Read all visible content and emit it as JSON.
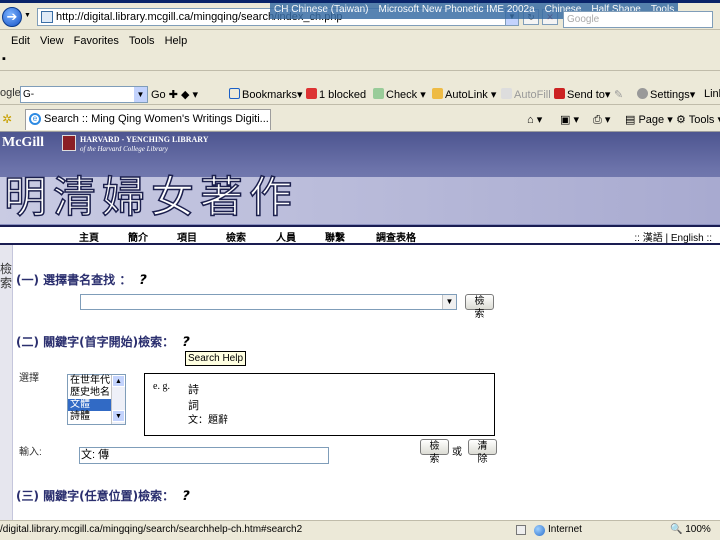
{
  "browser": {
    "address_url": "http://digital.library.mcgill.ca/mingqing/search/index_ch.php",
    "language_bar": [
      "CH Chinese (Taiwan)",
      "Microsoft New Phonetic IME 2002a",
      "Chinese",
      "Half Shape",
      "Tools"
    ],
    "search_placeholder": "Google",
    "menu": [
      "Edit",
      "View",
      "Favorites",
      "Tools",
      "Help"
    ],
    "google_toolbar": {
      "logo": "ogle",
      "combo_value": "G-",
      "go": "Go",
      "bookmarks": "Bookmarks",
      "blocked": "1 blocked",
      "check": "Check",
      "autolink": "AutoLink",
      "autofill": "AutoFill",
      "sendto": "Send to",
      "settings": "Settings",
      "link": "Link"
    },
    "tab_title": "Search :: Ming Qing Women's Writings Digiti...",
    "commands": {
      "page": "Page",
      "tools": "Tools"
    },
    "status": {
      "url": "/digital.library.mcgill.ca/mingqing/search/searchhelp-ch.htm#search2",
      "zone": "Internet",
      "zoom": "100%"
    },
    "colors": {
      "chrome": "#ece9d8",
      "header_purple": "#5a6099",
      "section_heading": "#2a2e6e"
    }
  },
  "site": {
    "mcgill": "McGill",
    "harvard_line1": "HARVARD - YENCHING LIBRARY",
    "harvard_line2": "of the Harvard College Library",
    "title": "明清婦女著作",
    "nav": [
      "主頁",
      "簡介",
      "項目",
      "檢索",
      "人員",
      "聯繫",
      "調查表格"
    ],
    "lang_links": ":: 漢語 | English ::",
    "sidebar_label": "檢索"
  },
  "search": {
    "section1": "(一) 選擇書名查找 ：",
    "section2": "(二) 關鍵字(首字開始)檢索：",
    "section3": "(三) 關鍵字(任意位置)檢索：",
    "search_button": "檢索",
    "search_button2": "檢索",
    "clear_button": "清除",
    "or_text": "或",
    "help_tooltip": "Search Help",
    "select_label": "選擇",
    "input_label": "輸入:",
    "categories": [
      "在世年代",
      "歷史地名",
      "文體",
      "詩體"
    ],
    "selected_category": "文體",
    "example_label": "e. g.",
    "examples": [
      "詩",
      "詞",
      "文：題辭"
    ],
    "input_value": "文: 傳"
  }
}
